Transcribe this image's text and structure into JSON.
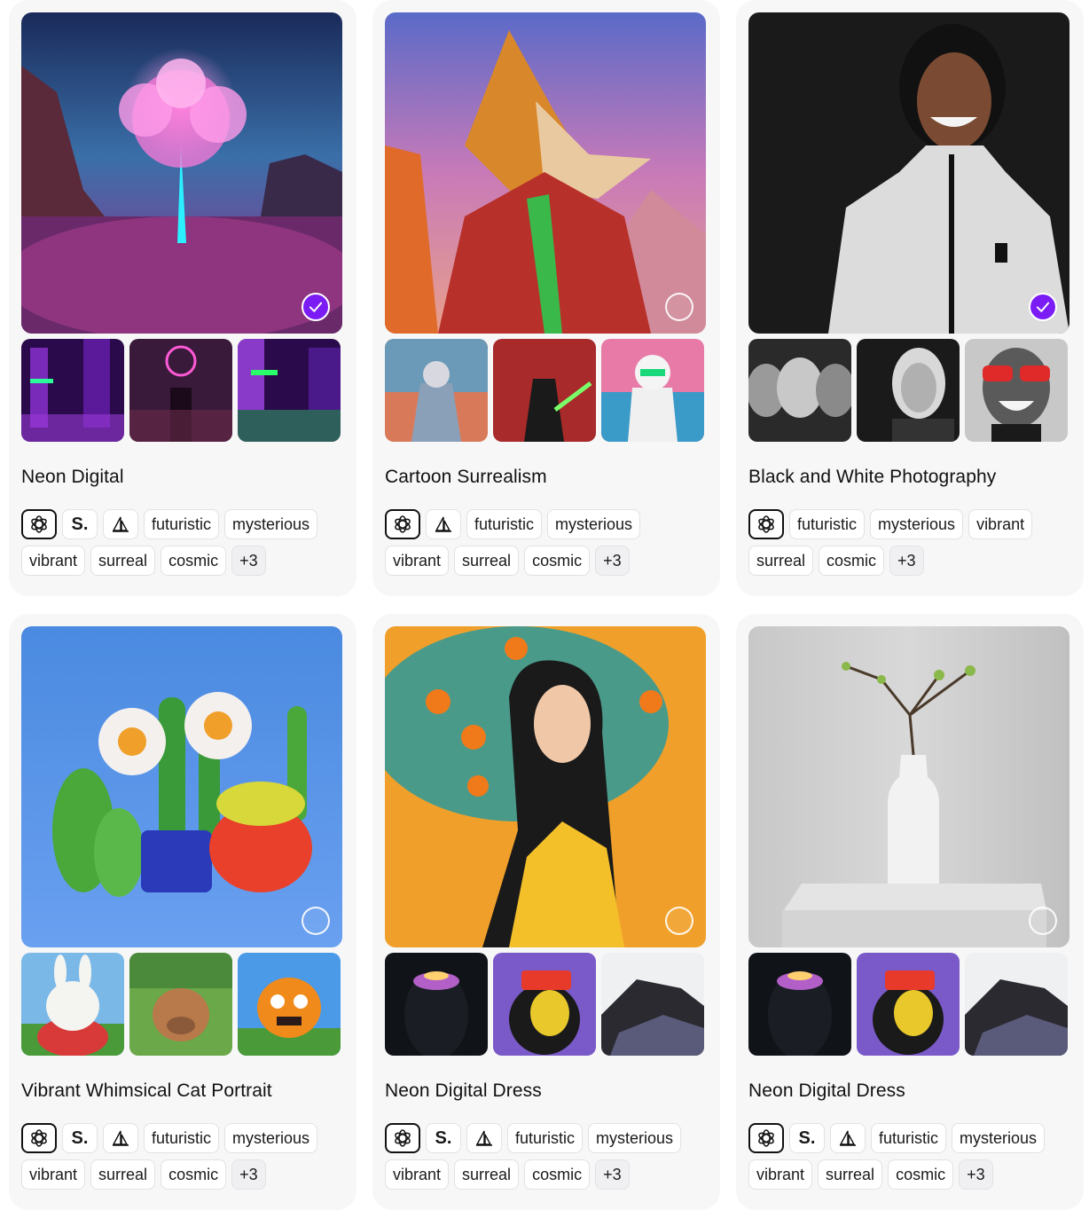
{
  "cards": [
    {
      "title": "Neon Digital",
      "selected": true,
      "model_icons": [
        "openai-icon",
        "s-dot-badge",
        "sail-icon"
      ],
      "tags": [
        "futuristic",
        "mysterious",
        "vibrant",
        "surreal",
        "cosmic"
      ],
      "more": "+3",
      "s_label": "S."
    },
    {
      "title": "Cartoon Surrealism",
      "selected": false,
      "model_icons": [
        "openai-icon",
        "sail-icon"
      ],
      "tags": [
        "futuristic",
        "mysterious",
        "vibrant",
        "surreal",
        "cosmic"
      ],
      "more": "+3"
    },
    {
      "title": "Black and White Photography",
      "selected": true,
      "model_icons": [
        "openai-icon"
      ],
      "tags": [
        "futuristic",
        "mysterious",
        "vibrant",
        "surreal",
        "cosmic"
      ],
      "more": "+3"
    },
    {
      "title": "Vibrant Whimsical Cat Portrait",
      "selected": false,
      "model_icons": [
        "openai-icon",
        "s-dot-badge",
        "sail-icon"
      ],
      "tags": [
        "futuristic",
        "mysterious",
        "vibrant",
        "surreal",
        "cosmic"
      ],
      "more": "+3",
      "s_label": "S."
    },
    {
      "title": "Neon Digital Dress",
      "selected": false,
      "model_icons": [
        "openai-icon",
        "s-dot-badge",
        "sail-icon"
      ],
      "tags": [
        "futuristic",
        "mysterious",
        "vibrant",
        "surreal",
        "cosmic"
      ],
      "more": "+3",
      "s_label": "S."
    },
    {
      "title": "Neon Digital Dress",
      "selected": false,
      "model_icons": [
        "openai-icon",
        "s-dot-badge",
        "sail-icon"
      ],
      "tags": [
        "futuristic",
        "mysterious",
        "vibrant",
        "surreal",
        "cosmic"
      ],
      "more": "+3",
      "s_label": "S."
    }
  ],
  "colors": {
    "accent": "#7c1cf5",
    "card_bg": "#f7f7f8",
    "tag_border": "#e2e2e4"
  }
}
